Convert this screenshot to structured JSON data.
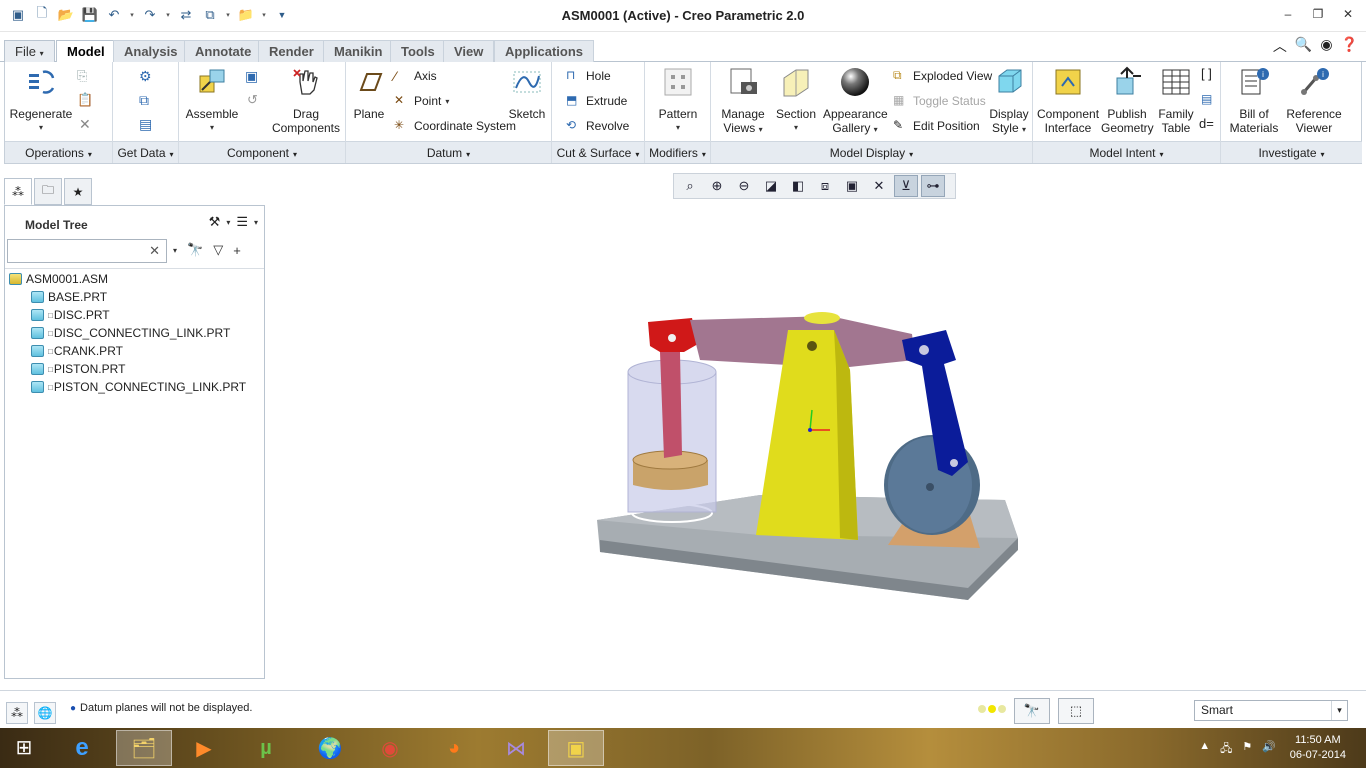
{
  "window": {
    "title": "ASM0001 (Active) - Creo Parametric 2.0"
  },
  "tabs": [
    {
      "label": "File"
    },
    {
      "label": "Model"
    },
    {
      "label": "Analysis"
    },
    {
      "label": "Annotate"
    },
    {
      "label": "Render"
    },
    {
      "label": "Manikin"
    },
    {
      "label": "Tools"
    },
    {
      "label": "View"
    },
    {
      "label": "Applications"
    }
  ],
  "ribbon": {
    "groups": [
      {
        "label": "Operations"
      },
      {
        "label": "Get Data"
      },
      {
        "label": "Component"
      },
      {
        "label": "Datum"
      },
      {
        "label": "Cut & Surface"
      },
      {
        "label": "Modifiers"
      },
      {
        "label": "Model Display"
      },
      {
        "label": "Model Intent"
      },
      {
        "label": "Investigate"
      }
    ],
    "buttons": {
      "regenerate": "Regenerate",
      "assemble": "Assemble",
      "drag_components_1": "Drag",
      "drag_components_2": "Components",
      "plane": "Plane",
      "axis": "Axis",
      "point": "Point",
      "coordinate_system": "Coordinate System",
      "sketch": "Sketch",
      "hole": "Hole",
      "extrude": "Extrude",
      "revolve": "Revolve",
      "pattern": "Pattern",
      "manage_views_1": "Manage",
      "manage_views_2": "Views",
      "section": "Section",
      "appearance_gallery_1": "Appearance",
      "appearance_gallery_2": "Gallery",
      "exploded_view": "Exploded View",
      "toggle_status": "Toggle Status",
      "edit_position": "Edit Position",
      "display_style_1": "Display",
      "display_style_2": "Style",
      "component_interface_1": "Component",
      "component_interface_2": "Interface",
      "publish_geometry_1": "Publish",
      "publish_geometry_2": "Geometry",
      "family_table_1": "Family",
      "family_table_2": "Table",
      "bill_of_materials_1": "Bill of",
      "bill_of_materials_2": "Materials",
      "reference_viewer_1": "Reference",
      "reference_viewer_2": "Viewer"
    }
  },
  "model_tree": {
    "title": "Model Tree",
    "search_placeholder": "",
    "items": [
      {
        "label": "ASM0001.ASM",
        "root": true
      },
      {
        "label": "BASE.PRT"
      },
      {
        "label": "DISC.PRT"
      },
      {
        "label": "DISC_CONNECTING_LINK.PRT"
      },
      {
        "label": "CRANK.PRT"
      },
      {
        "label": "PISTON.PRT"
      },
      {
        "label": "PISTON_CONNECTING_LINK.PRT"
      }
    ]
  },
  "status": {
    "message": "Datum planes will not be displayed.",
    "filter_value": "Smart"
  },
  "taskbar": {
    "time": "11:50 AM",
    "date": "06-07-2014"
  },
  "colors": {
    "accent": "#1a4fb0",
    "base": "#9aa3aa",
    "column": "#e0dc1c",
    "link_red": "#d11c1c",
    "link_blue": "#0b1c9a",
    "disc": "#4e6b86",
    "beam": "#a27690"
  }
}
